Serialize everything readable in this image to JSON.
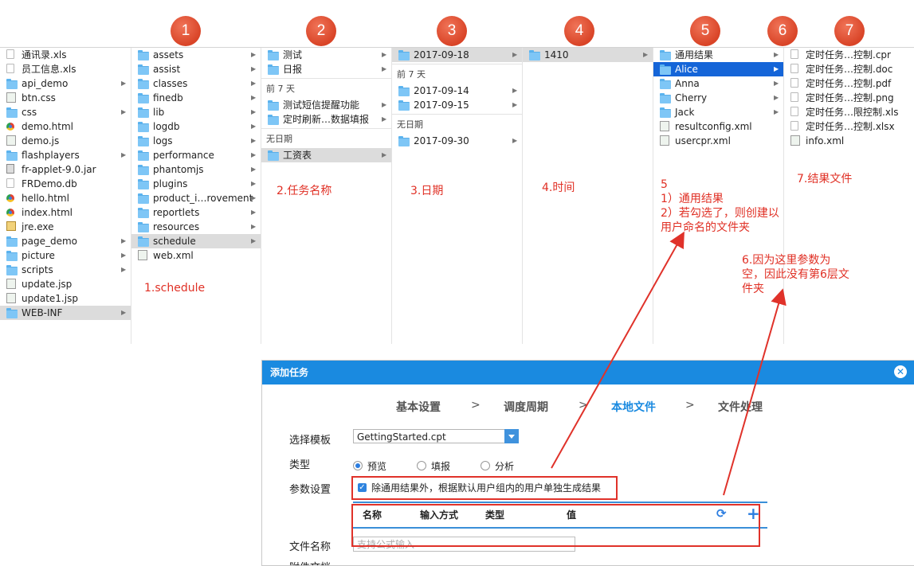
{
  "badges": [
    "1",
    "2",
    "3",
    "4",
    "5",
    "6",
    "7"
  ],
  "col0": [
    {
      "name": "通讯录.xls",
      "icon": "file"
    },
    {
      "name": "员工信息.xls",
      "icon": "file"
    },
    {
      "name": "api_demo",
      "icon": "folder",
      "arrow": true
    },
    {
      "name": "btn.css",
      "icon": "xml"
    },
    {
      "name": "css",
      "icon": "folder",
      "arrow": true
    },
    {
      "name": "demo.html",
      "icon": "chrome"
    },
    {
      "name": "demo.js",
      "icon": "xml"
    },
    {
      "name": "flashplayers",
      "icon": "folder",
      "arrow": true
    },
    {
      "name": "fr-applet-9.0.jar",
      "icon": "jar"
    },
    {
      "name": "FRDemo.db",
      "icon": "file"
    },
    {
      "name": "hello.html",
      "icon": "chrome"
    },
    {
      "name": "index.html",
      "icon": "chrome"
    },
    {
      "name": "jre.exe",
      "icon": "exe"
    },
    {
      "name": "page_demo",
      "icon": "folder",
      "arrow": true
    },
    {
      "name": "picture",
      "icon": "folder",
      "arrow": true
    },
    {
      "name": "scripts",
      "icon": "folder",
      "arrow": true
    },
    {
      "name": "update.jsp",
      "icon": "xml"
    },
    {
      "name": "update1.jsp",
      "icon": "xml"
    },
    {
      "name": "WEB-INF",
      "icon": "folder",
      "arrow": true,
      "selected": true
    }
  ],
  "col1": [
    {
      "name": "assets",
      "icon": "folder",
      "arrow": true
    },
    {
      "name": "assist",
      "icon": "folder",
      "arrow": true
    },
    {
      "name": "classes",
      "icon": "folder",
      "arrow": true
    },
    {
      "name": "finedb",
      "icon": "folder",
      "arrow": true
    },
    {
      "name": "lib",
      "icon": "folder",
      "arrow": true
    },
    {
      "name": "logdb",
      "icon": "folder",
      "arrow": true
    },
    {
      "name": "logs",
      "icon": "folder",
      "arrow": true
    },
    {
      "name": "performance",
      "icon": "folder",
      "arrow": true
    },
    {
      "name": "phantomjs",
      "icon": "folder",
      "arrow": true
    },
    {
      "name": "plugins",
      "icon": "folder",
      "arrow": true
    },
    {
      "name": "product_i…rovement",
      "icon": "folder",
      "arrow": true
    },
    {
      "name": "reportlets",
      "icon": "folder",
      "arrow": true
    },
    {
      "name": "resources",
      "icon": "folder",
      "arrow": true
    },
    {
      "name": "schedule",
      "icon": "folder",
      "arrow": true,
      "selected": true
    },
    {
      "name": "web.xml",
      "icon": "xml"
    }
  ],
  "col2": {
    "top": [
      {
        "name": "测试",
        "icon": "folder",
        "arrow": true
      },
      {
        "name": "日报",
        "icon": "folder",
        "arrow": true
      }
    ],
    "header1": "前 7 天",
    "mid": [
      {
        "name": "测试短信提醒功能",
        "icon": "folder",
        "arrow": true
      },
      {
        "name": "定时刷新…数据填报",
        "icon": "folder",
        "arrow": true
      }
    ],
    "header2": "无日期",
    "bottom": [
      {
        "name": "工资表",
        "icon": "folder",
        "arrow": true,
        "selected": true
      }
    ]
  },
  "col3": {
    "top": [
      {
        "name": "2017-09-18",
        "icon": "folder",
        "arrow": true,
        "selected": true
      }
    ],
    "header1": "前 7 天",
    "mid": [
      {
        "name": "2017-09-14",
        "icon": "folder",
        "arrow": true
      },
      {
        "name": "2017-09-15",
        "icon": "folder",
        "arrow": true
      }
    ],
    "header2": "无日期",
    "bottom": [
      {
        "name": "2017-09-30",
        "icon": "folder",
        "arrow": true
      }
    ]
  },
  "col4": [
    {
      "name": "1410",
      "icon": "folder",
      "arrow": true,
      "selected": true
    }
  ],
  "col5": [
    {
      "name": "通用结果",
      "icon": "folder",
      "arrow": true
    },
    {
      "name": "Alice",
      "icon": "folder",
      "arrow": true,
      "highlight": true
    },
    {
      "name": "Anna",
      "icon": "folder",
      "arrow": true
    },
    {
      "name": "Cherry",
      "icon": "folder",
      "arrow": true
    },
    {
      "name": "Jack",
      "icon": "folder",
      "arrow": true
    },
    {
      "name": "resultconfig.xml",
      "icon": "xml"
    },
    {
      "name": "usercpr.xml",
      "icon": "xml"
    }
  ],
  "col6": [
    {
      "name": "定时任务…控制.cpr",
      "icon": "file"
    },
    {
      "name": "定时任务…控制.doc",
      "icon": "file"
    },
    {
      "name": "定时任务…控制.pdf",
      "icon": "file"
    },
    {
      "name": "定时任务…控制.png",
      "icon": "file"
    },
    {
      "name": "定时任务…限控制.xls",
      "icon": "file"
    },
    {
      "name": "定时任务…控制.xlsx",
      "icon": "file"
    },
    {
      "name": "info.xml",
      "icon": "xml"
    }
  ],
  "annotations": {
    "a1": "1.schedule",
    "a2": "2.任务名称",
    "a3": "3.日期",
    "a4": "4.时间",
    "a5_line1": "5",
    "a5_line2": "1）通用结果",
    "a5_line3": "2）若勾选了，则创建以",
    "a5_line4": "用户命名的文件夹",
    "a6_line1": "6.因为这里参数为",
    "a6_line2": "空，因此没有第6层文",
    "a6_line3": "件夹",
    "a7": "7.结果文件"
  },
  "dialog": {
    "title": "添加任务",
    "steps": [
      "基本设置",
      ">",
      "调度周期",
      ">",
      "本地文件",
      ">",
      "文件处理"
    ],
    "template_label": "选择模板",
    "template_value": "GettingStarted.cpt",
    "type_label": "类型",
    "type_options": [
      "预览",
      "填报",
      "分析"
    ],
    "param_label": "参数设置",
    "param_checkbox": "除通用结果外，根据默认用户组内的用户单独生成结果",
    "table_headers": [
      "名称",
      "输入方式",
      "类型",
      "值"
    ],
    "filename_label": "文件名称",
    "filename_placeholder": "支持公式输入",
    "next_label": "附件文档"
  },
  "colors": {
    "accent": "#1a8ae0",
    "annotation": "#e03025",
    "selection_blue": "#1565d8"
  }
}
